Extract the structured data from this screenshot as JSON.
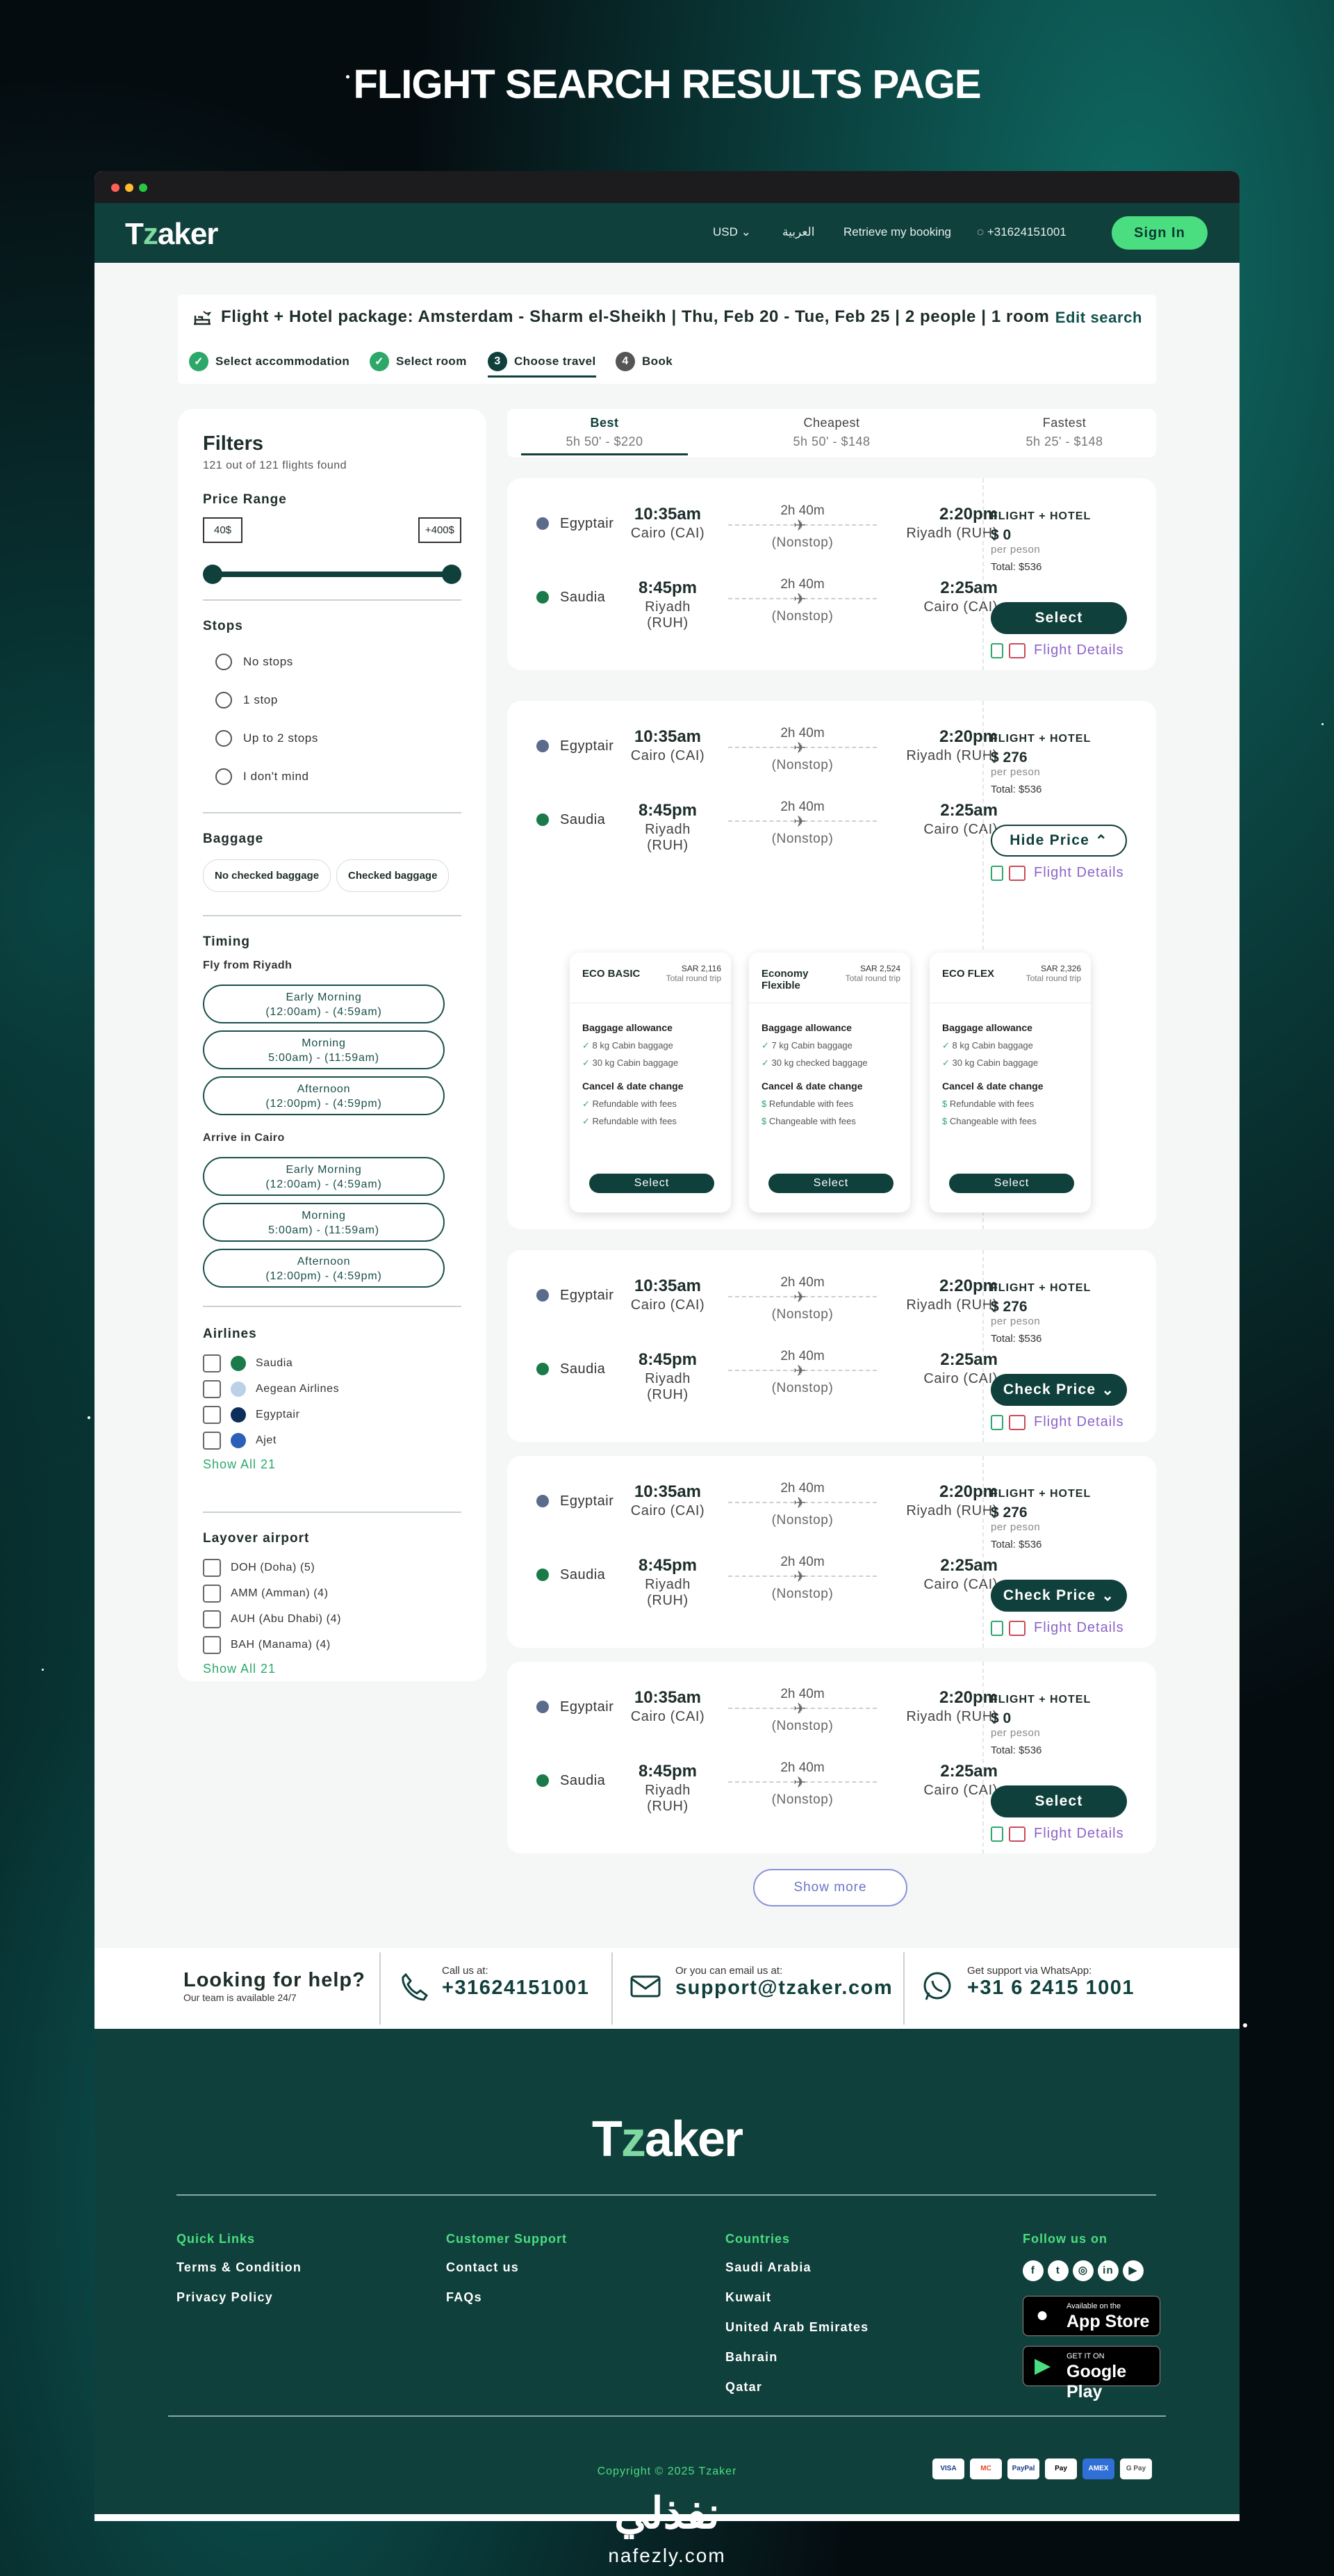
{
  "page_heading": "FLIGHT SEARCH RESULTS PAGE",
  "colors": {
    "primary": "#10403c",
    "accent": "#4ade80",
    "link": "#8b63c7"
  },
  "header": {
    "logo_t": "T",
    "logo_z": "z",
    "logo_rest": "aker",
    "currency": "USD",
    "language": "العربية",
    "retrieve": "Retrieve my booking",
    "phone": "+31624151001",
    "sign_in": "Sign In"
  },
  "banner": {
    "title": "Flight + Hotel package: Amsterdam - Sharm el-Sheikh | Thu, Feb 20 - Tue, Feb 25 | 2 people | 1 room",
    "edit": "Edit search",
    "steps": [
      {
        "num": "✓",
        "label": "Select accommodation"
      },
      {
        "num": "✓",
        "label": "Select room"
      },
      {
        "num": "3",
        "label": "Choose travel"
      },
      {
        "num": "4",
        "label": "Book"
      }
    ]
  },
  "filters": {
    "title": "Filters",
    "count": "121 out of 121 flights found",
    "price_range": {
      "label": "Price Range",
      "min": "40$",
      "max": "+400$"
    },
    "stops": {
      "label": "Stops",
      "options": [
        "No stops",
        "1 stop",
        "Up to 2 stops",
        "I don't mind"
      ]
    },
    "baggage": {
      "label": "Baggage",
      "options": [
        "No checked baggage",
        "Checked baggage"
      ]
    },
    "timing": {
      "label": "Timing",
      "fly_from": "Fly from Riyadh",
      "arrive_in": "Arrive in Cairo",
      "slots": [
        {
          "name": "Early Morning",
          "range": "(12:00am) - (4:59am)"
        },
        {
          "name": "Morning",
          "range": "5:00am) - (11:59am)"
        },
        {
          "name": "Afternoon",
          "range": "(12:00pm) - (4:59pm)"
        }
      ]
    },
    "airlines": {
      "label": "Airlines",
      "items": [
        "Saudia",
        "Aegean Airlines",
        "Egyptair",
        "Ajet"
      ],
      "show_all": "Show All 21"
    },
    "layover": {
      "label": "Layover airport",
      "items": [
        "DOH (Doha) (5)",
        "AMM (Amman) (4)",
        "AUH (Abu Dhabi) (4)",
        "BAH (Manama) (4)"
      ],
      "show_all": "Show All 21"
    }
  },
  "sort": [
    {
      "label": "Best",
      "info": "5h 50' - $220"
    },
    {
      "label": "Cheapest",
      "info": "5h 50' - $148"
    },
    {
      "label": "Fastest",
      "info": "5h 25' - $148"
    }
  ],
  "legs": {
    "out": {
      "airline": "Egyptair",
      "dep_time": "10:35am",
      "dep_city": "Cairo (CAI)",
      "duration": "2h 40m",
      "stops": "(Nonstop)",
      "arr_time": "2:20pm",
      "arr_city": "Riyadh (RUH)"
    },
    "ret": {
      "airline": "Saudia",
      "dep_time": "8:45pm",
      "dep_city": "Riyadh (RUH)",
      "duration": "2h 40m",
      "stops": "(Nonstop)",
      "arr_time": "2:25am",
      "arr_city": "Cairo (CAI)"
    }
  },
  "results": [
    {
      "label": "FLIGHT + HOTEL",
      "price": "$ 0",
      "per": "per peson",
      "total": "Total: $536",
      "button": "Select",
      "details": "Flight Details"
    },
    {
      "label": "FLIGHT + HOTEL",
      "price": "$ 276",
      "per": "per peson",
      "total": "Total: $536",
      "button": "Hide Price",
      "details": "Flight Details"
    },
    {
      "label": "FLIGHT + HOTEL",
      "price": "$ 276",
      "per": "per peson",
      "total": "Total: $536",
      "button": "Check Price",
      "details": "Flight Details"
    },
    {
      "label": "FLIGHT + HOTEL",
      "price": "$ 276",
      "per": "per peson",
      "total": "Total: $536",
      "button": "Check Price",
      "details": "Flight Details"
    },
    {
      "label": "FLIGHT + HOTEL",
      "price": "$ 0",
      "per": "per peson",
      "total": "Total: $536",
      "button": "Select",
      "details": "Flight Details"
    }
  ],
  "fares": [
    {
      "name": "ECO BASIC",
      "price": "SAR 2,116",
      "note": "Total round trip",
      "bag_title": "Baggage allowance",
      "bag": [
        "8 kg Cabin baggage",
        "30 kg Cabin baggage"
      ],
      "cancel_title": "Cancel & date change",
      "cancel": [
        "Refundable with fees",
        "Refundable with fees"
      ],
      "select": "Select"
    },
    {
      "name": "Economy Flexible",
      "price": "SAR 2,524",
      "note": "Total round trip",
      "bag_title": "Baggage allowance",
      "bag": [
        "7 kg Cabin baggage",
        "30 kg checked baggage"
      ],
      "cancel_title": "Cancel & date change",
      "cancel": [
        "Refundable with fees",
        "Changeable with fees"
      ],
      "select": "Select"
    },
    {
      "name": "ECO FLEX",
      "price": "SAR 2,326",
      "note": "Total round trip",
      "bag_title": "Baggage allowance",
      "bag": [
        "8 kg Cabin baggage",
        "30 kg Cabin baggage"
      ],
      "cancel_title": "Cancel & date change",
      "cancel": [
        "Refundable with fees",
        "Changeable with fees"
      ],
      "select": "Select"
    }
  ],
  "show_more": "Show more",
  "help": {
    "title": "Looking for help?",
    "subtitle": "Our team is available 24/7",
    "call_label": "Call us at:",
    "call": "+31624151001",
    "email_label": "Or you can email us at:",
    "email": "support@tzaker.com",
    "wa_label": "Get support via WhatsApp:",
    "wa": "+31 6 2415 1001"
  },
  "footer": {
    "quick": {
      "title": "Quick Links",
      "items": [
        "Terms & Condition",
        "Privacy Policy"
      ]
    },
    "support": {
      "title": "Customer Support",
      "items": [
        "Contact us",
        "FAQs"
      ]
    },
    "countries": {
      "title": "Countries",
      "items": [
        "Saudi Arabia",
        "Kuwait",
        "United Arab Emirates",
        "Bahrain",
        "Qatar"
      ]
    },
    "follow": "Follow us on",
    "app_store_small": "Available on the",
    "app_store": "App Store",
    "play_small": "GET IT ON",
    "play": "Google Play",
    "copyright": "Copyright © 2025 Tzaker",
    "payments": [
      "VISA",
      "MC",
      "PayPal",
      "Pay",
      "AMEX",
      "G Pay"
    ]
  },
  "watermark": {
    "arabic": "نفذلي",
    "latin": "nafezly.com"
  }
}
